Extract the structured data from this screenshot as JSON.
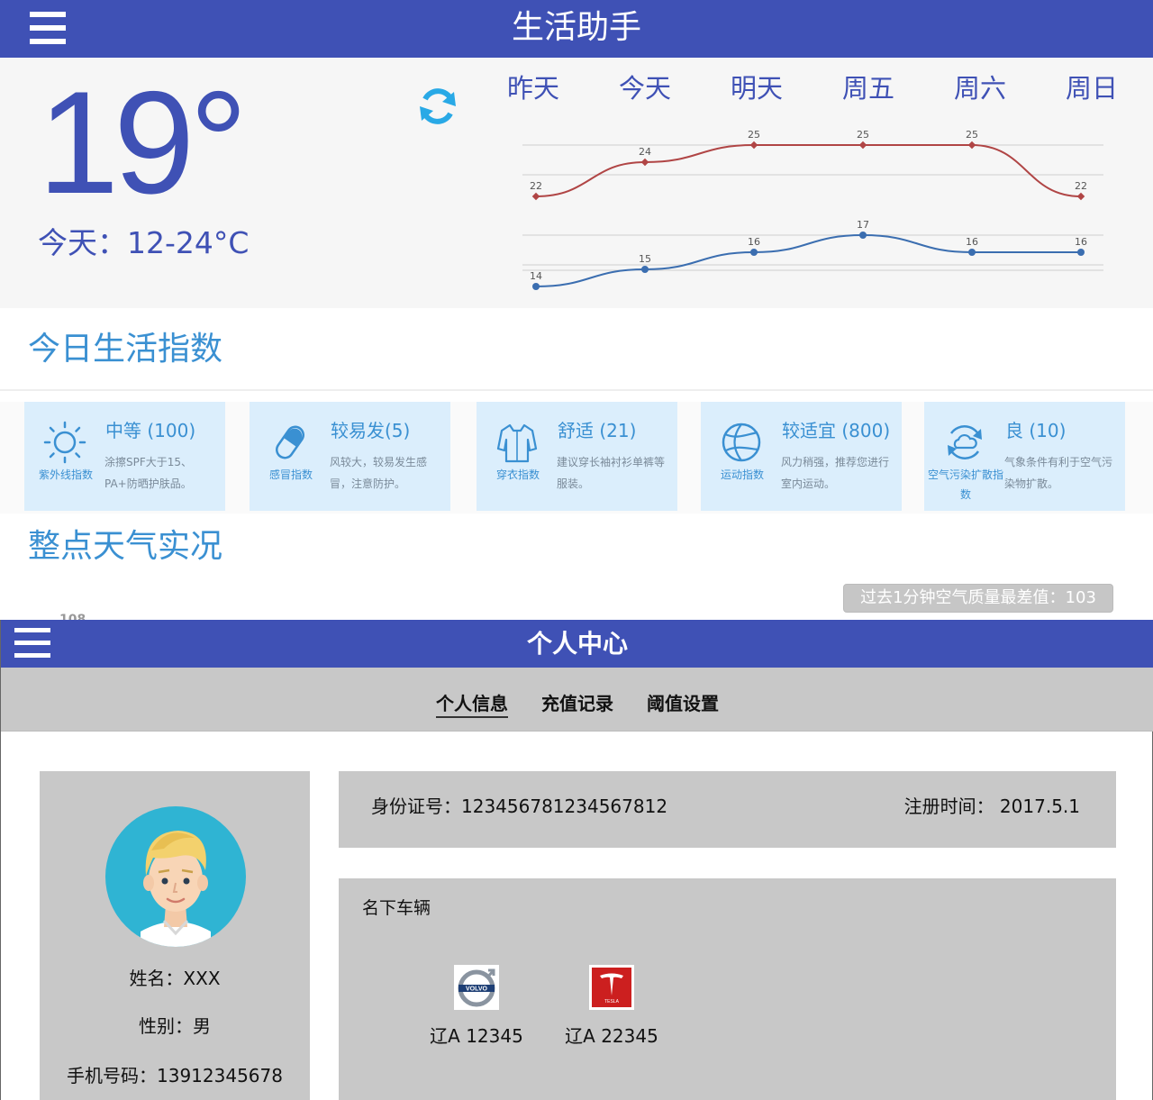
{
  "app": {
    "title": "生活助手",
    "current_temp": "19°",
    "today_range": "今天：12-24°C",
    "days": [
      "昨天",
      "今天",
      "明天",
      "周五",
      "周六",
      "周日"
    ]
  },
  "chart_data": {
    "type": "line",
    "categories": [
      "昨天",
      "今天",
      "明天",
      "周五",
      "周六",
      "周日"
    ],
    "series": [
      {
        "values": [
          22,
          24,
          25,
          25,
          25,
          22
        ],
        "color": "#b04545"
      },
      {
        "values": [
          14,
          15,
          16,
          17,
          16,
          16
        ],
        "color": "#3b6eb0"
      }
    ],
    "grid": true
  },
  "life_index": {
    "title": "今日生活指数",
    "cards": [
      {
        "icon": "sun-icon",
        "label": "紫外线指数",
        "value": "中等 (100)",
        "desc": "涂擦SPF大于15、PA+防晒护肤品。"
      },
      {
        "icon": "pill-icon",
        "label": "感冒指数",
        "value": "较易发(5)",
        "desc": "风较大，较易发生感冒，注意防护。"
      },
      {
        "icon": "shirt-icon",
        "label": "穿衣指数",
        "value": "舒适 (21)",
        "desc": "建议穿长袖衬衫单裤等服装。"
      },
      {
        "icon": "basketball-icon",
        "label": "运动指数",
        "value": "较适宜 (800)",
        "desc": "风力稍强，推荐您进行室内运动。"
      },
      {
        "icon": "cloud-cycle-icon",
        "label": "空气污染扩散指数",
        "value": "良 (10)",
        "desc": "气象条件有利于空气污染物扩散。"
      }
    ]
  },
  "hourly": {
    "title": "整点天气实况",
    "aqi_badge": "过去1分钟空气质量最差值：103",
    "axis_peek": "108"
  },
  "personal": {
    "title": "个人中心",
    "tabs": [
      "个人信息",
      "充值记录",
      "阈值设置"
    ],
    "active_tab": "个人信息",
    "name": "姓名：XXX",
    "gender": "性别：男",
    "phone": "手机号码：13912345678",
    "id_number": "身份证号：123456781234567812",
    "register_time": "注册时间： 2017.5.1",
    "vehicles_title": "名下车辆",
    "vehicles": [
      {
        "brand": "VOLVO",
        "plate": "辽A 12345"
      },
      {
        "brand": "TESLA",
        "plate": "辽A 22345"
      }
    ]
  }
}
